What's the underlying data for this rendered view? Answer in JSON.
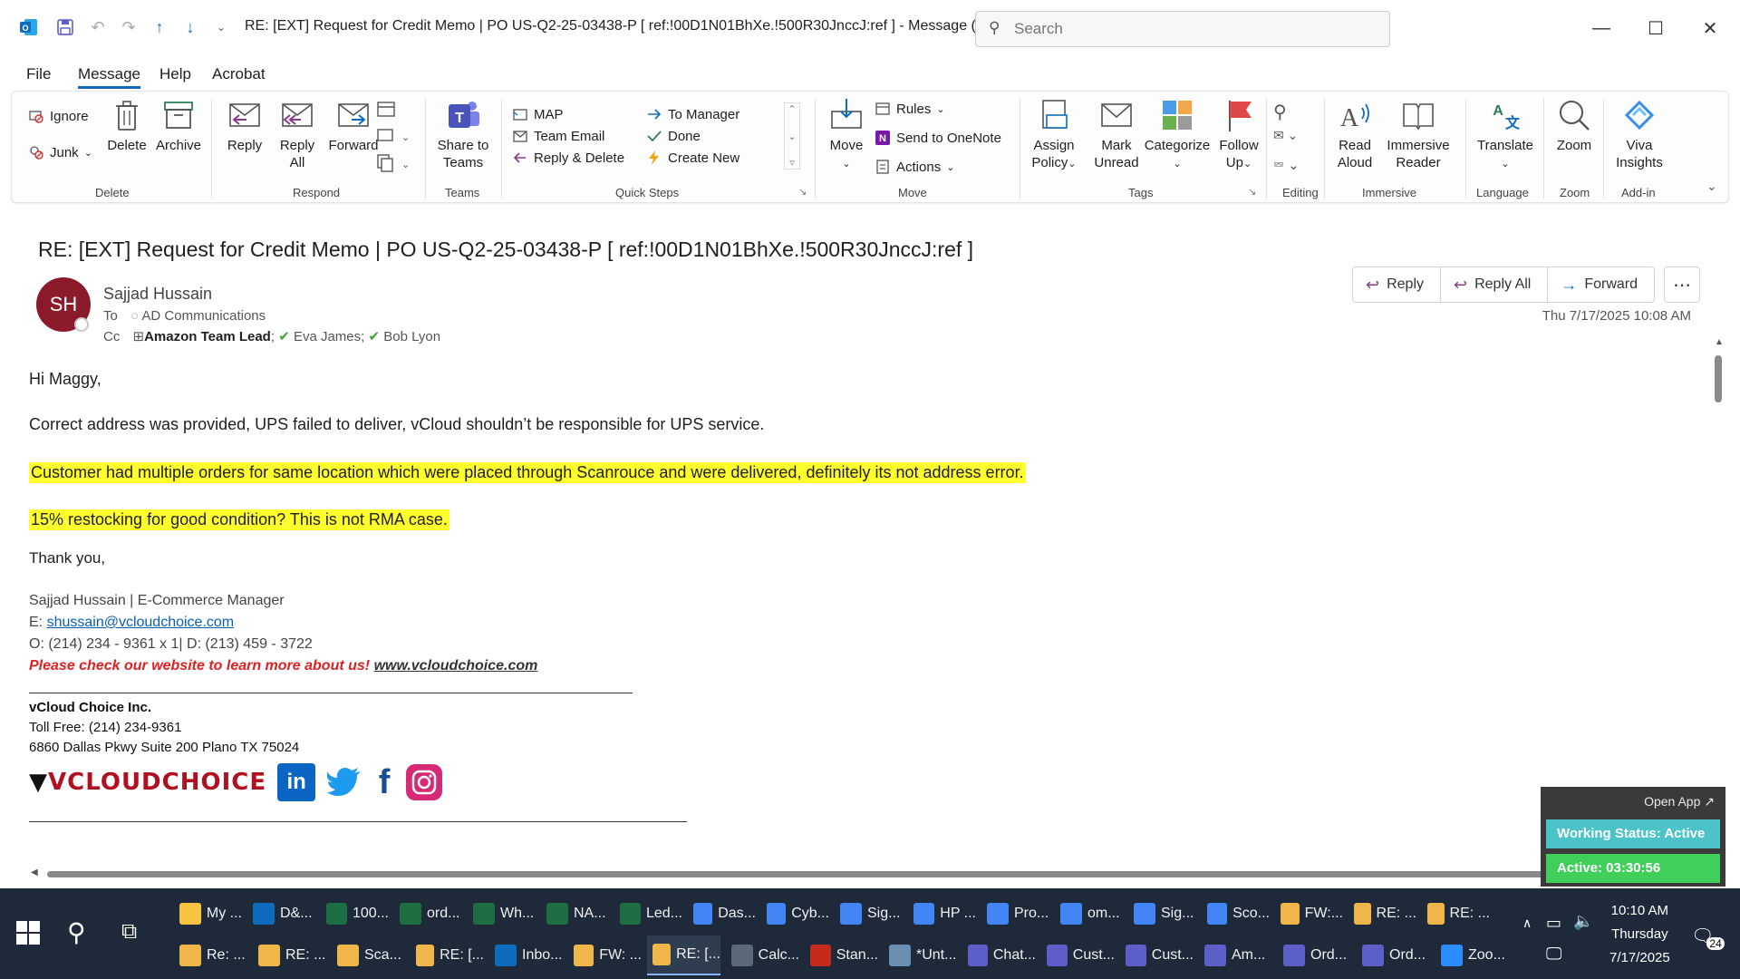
{
  "window": {
    "title": "RE: [EXT] Request for Credit Memo | PO US-Q2-25-03438-P    [ ref:!00D1N01BhXe.!500R30JnccJ:ref ]  -  Message (HT...",
    "search_placeholder": "Search"
  },
  "menu": [
    "File",
    "Message",
    "Help",
    "Acrobat"
  ],
  "ribbon": {
    "delete_group": {
      "ignore": "Ignore",
      "junk": "Junk",
      "delete": "Delete",
      "archive": "Archive",
      "label": "Delete"
    },
    "respond_group": {
      "reply": "Reply",
      "reply_all_1": "Reply",
      "reply_all_2": "All",
      "forward": "Forward",
      "label": "Respond"
    },
    "teams_group": {
      "share_1": "Share to",
      "share_2": "Teams",
      "label": "Teams"
    },
    "quicksteps": {
      "map": "MAP",
      "team_email": "Team Email",
      "reply_delete": "Reply & Delete",
      "to_manager": "To Manager",
      "done": "Done",
      "create_new": "Create New",
      "label": "Quick Steps"
    },
    "move_group": {
      "move": "Move",
      "rules": "Rules",
      "onenote": "Send to OneNote",
      "actions": "Actions",
      "label": "Move"
    },
    "tags_group": {
      "assign_1": "Assign",
      "assign_2": "Policy",
      "mark_1": "Mark",
      "mark_2": "Unread",
      "categorize": "Categorize",
      "follow_1": "Follow",
      "follow_2": "Up",
      "label": "Tags"
    },
    "editing_group": {
      "label": "Editing"
    },
    "immersive_group": {
      "read_1": "Read",
      "read_2": "Aloud",
      "imm_1": "Immersive",
      "imm_2": "Reader",
      "label": "Immersive"
    },
    "language_group": {
      "translate": "Translate",
      "label": "Language"
    },
    "zoom_group": {
      "zoom": "Zoom",
      "label": "Zoom"
    },
    "addin_group": {
      "viva_1": "Viva",
      "viva_2": "Insights",
      "label": "Add-in"
    }
  },
  "email": {
    "subject": "RE: [EXT] Request for Credit Memo | PO US-Q2-25-03438-P    [ ref:!00D1N01BhXe.!500R30JnccJ:ref ]",
    "avatar_initials": "SH",
    "sender": "Sajjad Hussain",
    "to_label": "To",
    "to": "AD Communications",
    "cc_label": "Cc",
    "cc_group": "Amazon Team Lead",
    "cc_1": "Eva James",
    "cc_2": "Bob Lyon",
    "date": "Thu 7/17/2025 10:08 AM",
    "actions": {
      "reply": "Reply",
      "reply_all": "Reply All",
      "forward": "Forward"
    },
    "body": {
      "greeting": "Hi Maggy,",
      "line1": "Correct address was provided, UPS failed to deliver, vCloud shouldn’t be responsible for UPS service.",
      "line2": "Customer had multiple orders for same location which were placed through Scanrouce and were delivered, definitely its not address error.",
      "line3": "15% restocking for good condition? This is not RMA case.",
      "closing": "Thank you,"
    },
    "signature": {
      "name_title": "Sajjad Hussain | E-Commerce Manager",
      "email_label": "E: ",
      "email": "shussain@vcloudchoice.com",
      "phone": "O: (214) 234 - 9361 x 1| D: (213) 459 - 3722",
      "promo": "Please check our website to learn more about us!",
      "website": "www.vcloudchoice.com",
      "company": "vCloud Choice Inc.",
      "tollfree": "Toll Free: (214) 234-9361",
      "address": "6860 Dallas Pkwy Suite 200 Plano TX 75024",
      "logo_text": "VCLOUDCHOICE"
    }
  },
  "widget": {
    "open_app": "Open App ↗",
    "status": "Working Status: Active",
    "active": "Active: 03:30:56"
  },
  "taskbar": {
    "row1": [
      "My ...",
      "D&...",
      "100...",
      "ord...",
      "Wh...",
      "NA...",
      "Led...",
      "Das...",
      "Cyb...",
      "Sig...",
      "HP ...",
      "Pro...",
      "om...",
      "Sig...",
      "Sco...",
      "FW:...",
      "RE: ...",
      "RE: ..."
    ],
    "row2": [
      "Re: ...",
      "RE: ...",
      "Sca...",
      "RE: [...",
      "Inbo...",
      "FW: ...",
      "RE: [...",
      "Calc...",
      "Stan...",
      "*Unt...",
      "Chat...",
      "Cust...",
      "Cust...",
      "Am...",
      "Ord...",
      "Ord...",
      "Zoo..."
    ],
    "time": "10:10 AM",
    "day": "Thursday",
    "date": "7/17/2025",
    "notif": "24"
  },
  "colors": {
    "accent": "#0f6cbd",
    "avatar": "#8b1a2b",
    "highlight": "#ffff2e",
    "taskbar": "#1e2a3a"
  }
}
